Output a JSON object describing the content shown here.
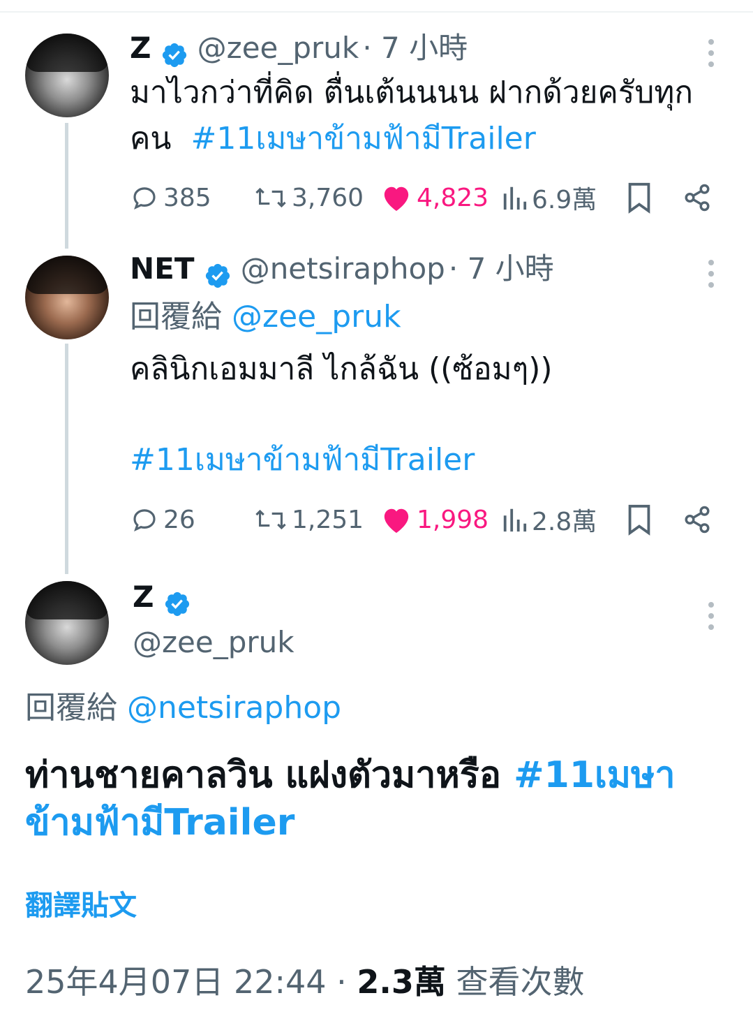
{
  "tweet1": {
    "name": "Z",
    "handle": "@zee_pruk",
    "time": "· 7 小時",
    "text_line1": "มาไวกว่าที่คิด ตื่นเต้นนนน ฝากด้วยครับทุก",
    "text_line2": "คน",
    "hashtag": "#11เมษาข้ามฟ้ามีTrailer",
    "replies": "385",
    "retweets": "3,760",
    "likes": "4,823",
    "views": "6.9萬"
  },
  "tweet2": {
    "name": "NET",
    "handle": "@netsiraphop",
    "time": "· 7 小時",
    "reply_prefix": "回覆給",
    "reply_to": "@zee_pruk",
    "text": "คลินิกเอมมาลี ไกล้ฉัน ((ซ้อมๆ))",
    "hashtag": "#11เมษาข้ามฟ้ามีTrailer",
    "replies": "26",
    "retweets": "1,251",
    "likes": "1,998",
    "views": "2.8萬"
  },
  "tweet3": {
    "name": "Z",
    "handle": "@zee_pruk",
    "reply_prefix": "回覆給",
    "reply_to": "@netsiraphop",
    "text": "ท่านชายคาลวิน แฝงตัวมาหรือ",
    "hashtag_line1": "#11เมษา",
    "hashtag_line2": "ข้ามฟ้ามีTrailer",
    "translate": "翻譯貼文",
    "timestamp": "25年4月07日 22:44",
    "sep": "·",
    "views": "2.3萬",
    "views_label": "查看次數"
  },
  "colors": {
    "accent": "#1d9bf0",
    "like": "#f91880",
    "secondary_text": "#536471",
    "thread_line": "#cfd9de"
  },
  "icons": [
    "reply-icon",
    "retweet-icon",
    "heart-icon",
    "views-icon",
    "bookmark-icon",
    "share-icon",
    "verified-icon",
    "more-icon"
  ]
}
